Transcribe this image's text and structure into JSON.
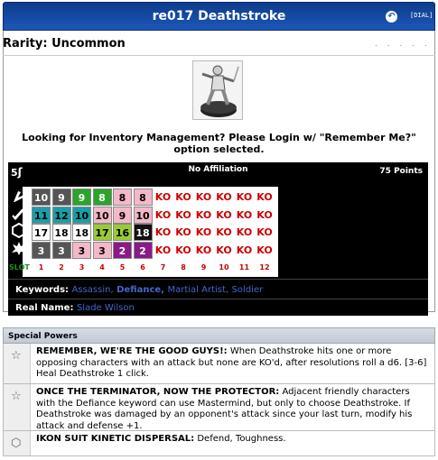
{
  "header": {
    "title": "re017 Deathstroke",
    "dial_button": "[DIAL]"
  },
  "rarity": "Rarity: Uncommon",
  "dots": ". . . . .",
  "inventory_message": "Looking for Inventory Management? Please Login w/ \"Remember Me?\" option selected.",
  "dial": {
    "speed": "5",
    "affiliation": "No Affiliation",
    "points": "75 Points",
    "slot_label": "SLOT",
    "slots": [
      "1",
      "2",
      "3",
      "4",
      "5",
      "6",
      "7",
      "8",
      "9",
      "10",
      "11",
      "12"
    ],
    "rows": [
      [
        "10",
        "9",
        "9",
        "8",
        "8",
        "8",
        "KO",
        "KO",
        "KO",
        "KO",
        "KO",
        "KO"
      ],
      [
        "11",
        "12",
        "10",
        "10",
        "9",
        "10",
        "KO",
        "KO",
        "KO",
        "KO",
        "KO",
        "KO"
      ],
      [
        "17",
        "18",
        "18",
        "17",
        "16",
        "18",
        "KO",
        "KO",
        "KO",
        "KO",
        "KO",
        "KO"
      ],
      [
        "3",
        "3",
        "3",
        "3",
        "2",
        "2",
        "KO",
        "KO",
        "KO",
        "KO",
        "KO",
        "KO"
      ]
    ],
    "cell_colors": [
      [
        "#555555",
        "#555555",
        "#2aa52a",
        "#2aa52a",
        "#f4b8c8",
        "#f4b8c8"
      ],
      [
        "#1a9ea8",
        "#1a9ea8",
        "#1a9ea8",
        "#f4b8c8",
        "#f4b8c8",
        "#f4b8c8"
      ],
      [
        "#ffffff",
        "#ffffff",
        "#ffffff",
        "#99cc33",
        "#99cc33",
        "#111111"
      ],
      [
        "#555555",
        "#555555",
        "#f4b8c8",
        "#f4b8c8",
        "#8a1a8a",
        "#8a1a8a"
      ]
    ]
  },
  "keywords": {
    "label": "Keywords:",
    "items": [
      "Assassin,",
      "Defiance,",
      "Martial Artist,",
      "Soldier"
    ]
  },
  "real_name": {
    "label": "Real Name:",
    "value": "Slade Wilson"
  },
  "special_powers": {
    "title": "Special Powers",
    "items": [
      {
        "icon": "star-icon",
        "name": "REMEMBER, WE'RE THE GOOD GUYS!:",
        "text": " When Deathstroke hits one or more opposing characters with an attack but none are KO'd, after resolutions roll a d6. [3-6] Heal Deathstroke 1 click."
      },
      {
        "icon": "star-icon",
        "name": "ONCE THE TERMINATOR, NOW THE PROTECTOR:",
        "text": " Adjacent friendly characters with the Defiance keyword can use Mastermind, but only to choose Deathstroke. If Deathstroke was damaged by an opponent's attack since your last turn, modify his attack and defense +1."
      },
      {
        "icon": "shield-icon",
        "name": "IKON SUIT KINETIC DISPERSAL:",
        "text": " Defend, Toughness."
      }
    ]
  }
}
